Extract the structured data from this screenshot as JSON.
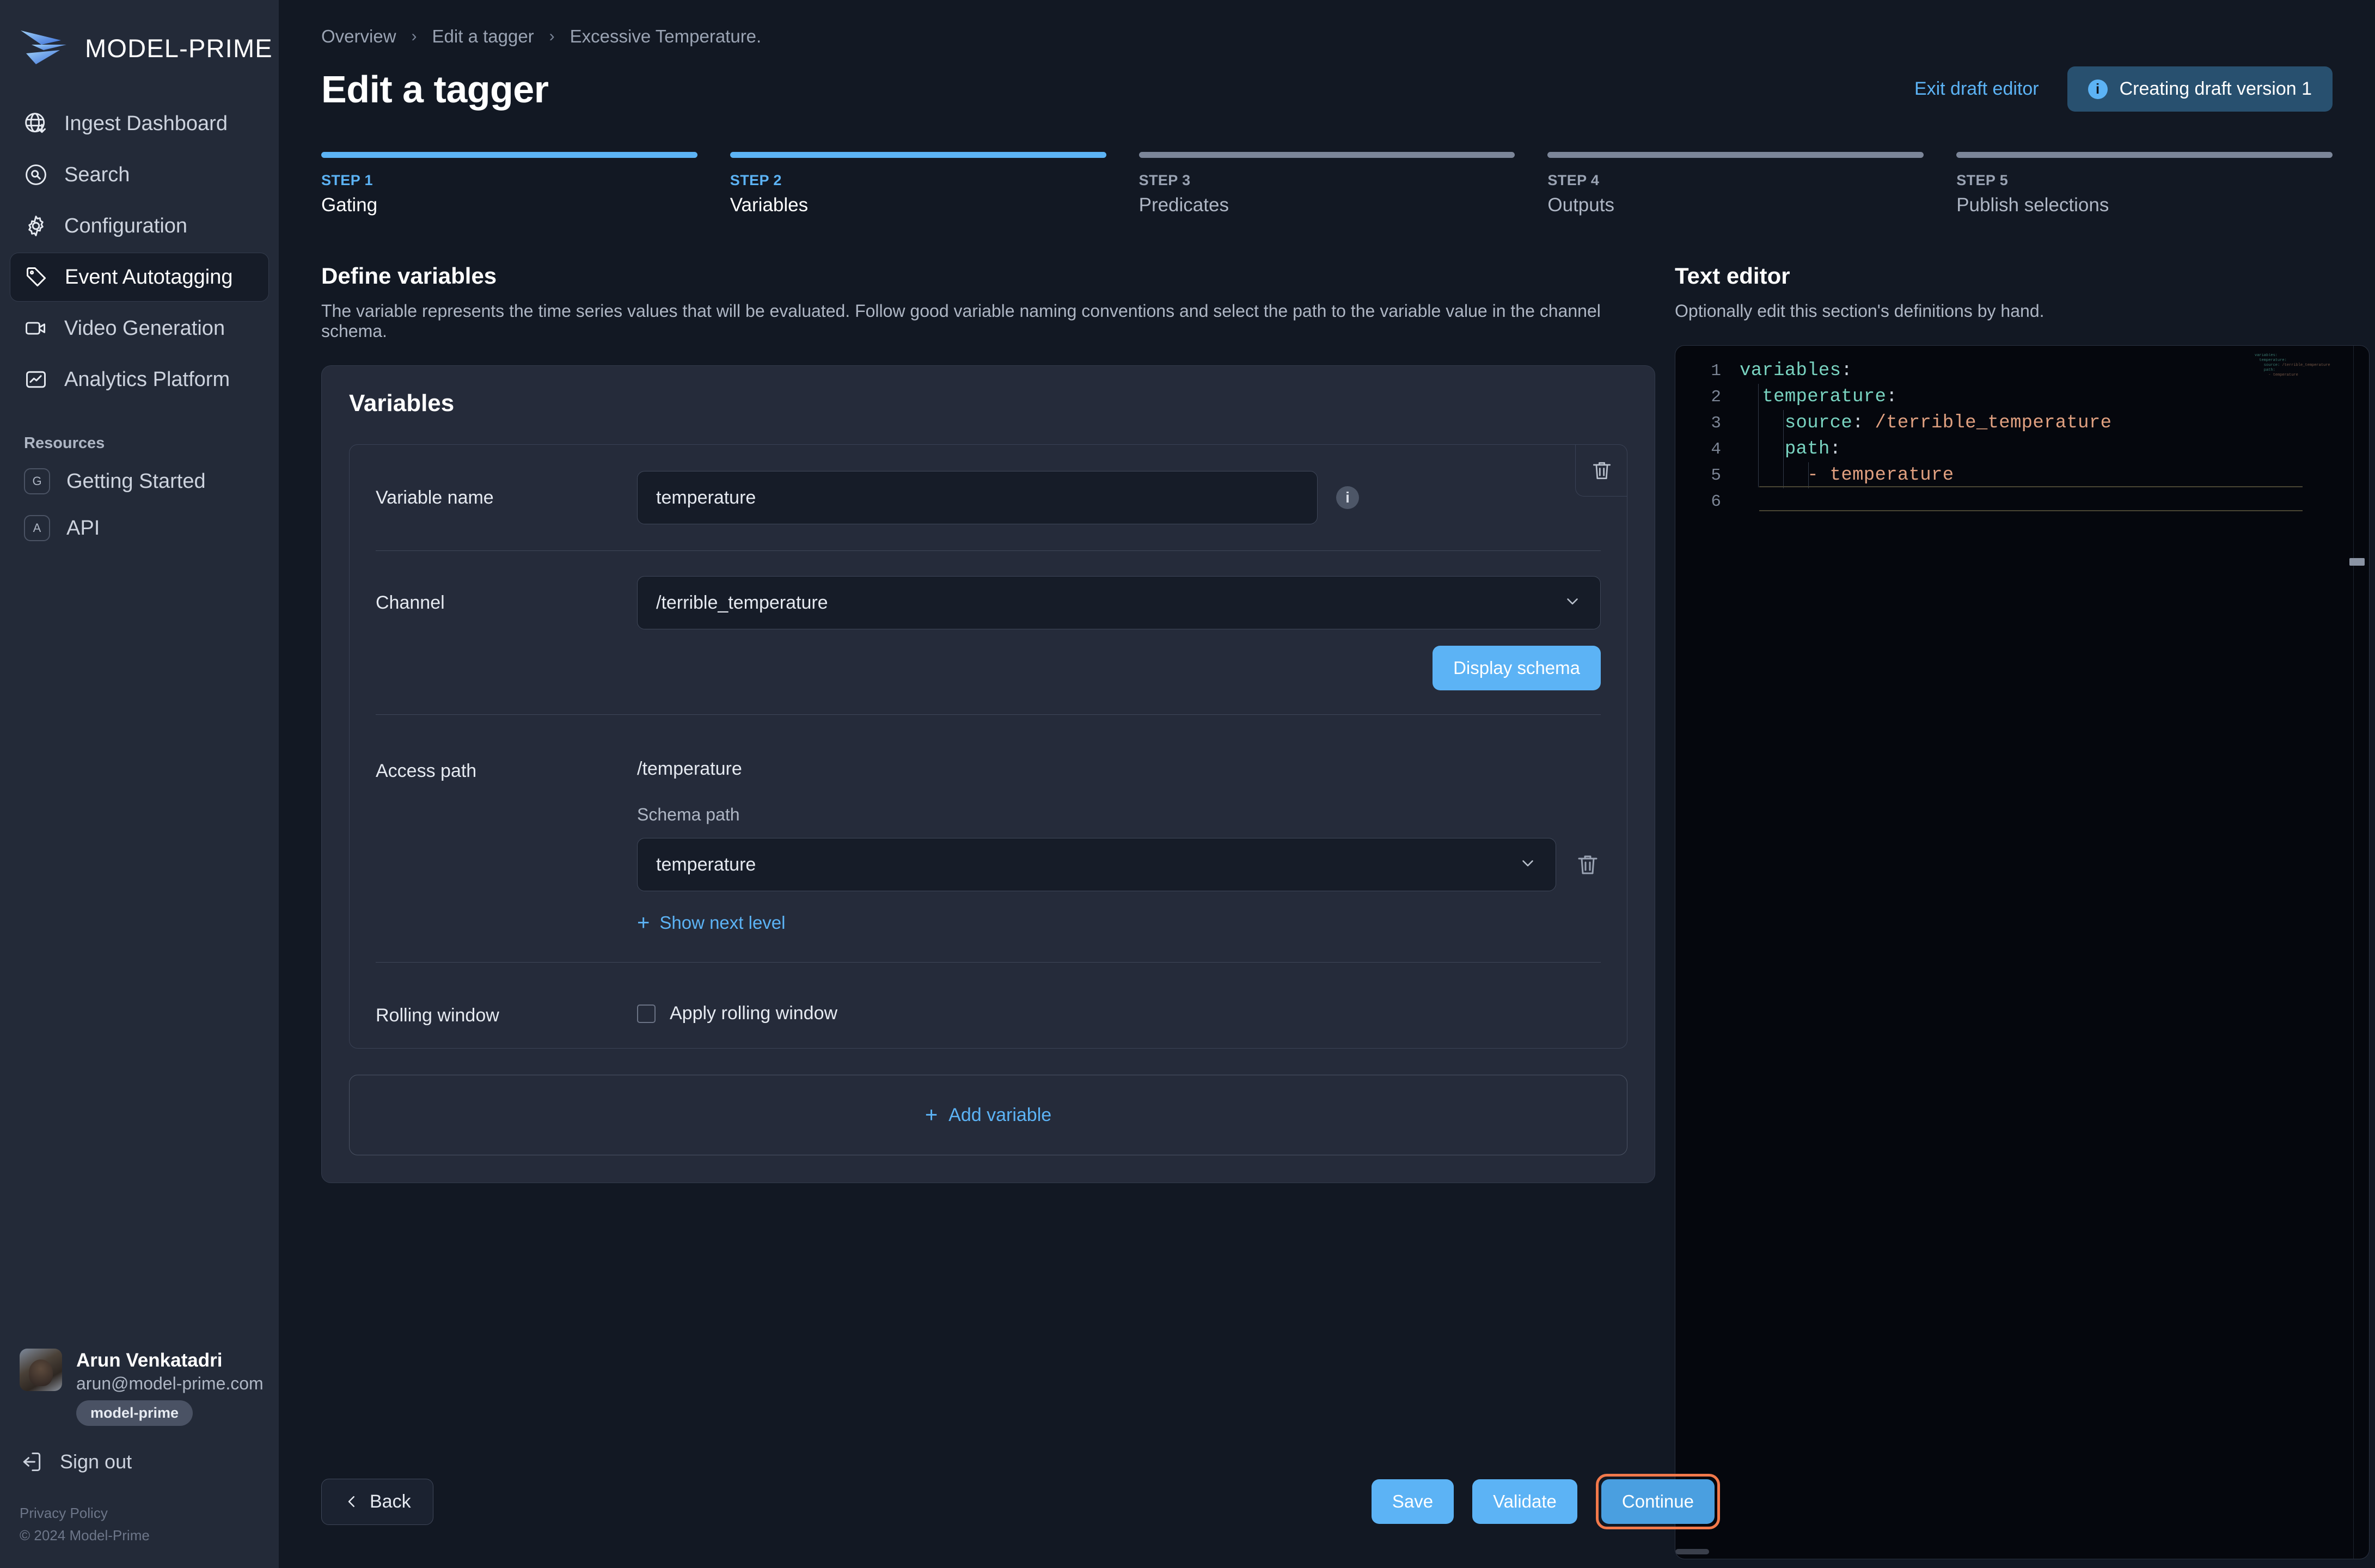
{
  "brand": {
    "name": "MODEL-PRIME"
  },
  "sidebar": {
    "nav": [
      {
        "label": "Ingest Dashboard",
        "icon": "globe-download-icon"
      },
      {
        "label": "Search",
        "icon": "search-circle-icon"
      },
      {
        "label": "Configuration",
        "icon": "gear-icon"
      },
      {
        "label": "Event Autotagging",
        "icon": "tag-icon"
      },
      {
        "label": "Video Generation",
        "icon": "video-camera-icon"
      },
      {
        "label": "Analytics Platform",
        "icon": "chart-image-icon"
      }
    ],
    "resources_heading": "Resources",
    "resources": [
      {
        "label": "Getting Started",
        "badge": "G"
      },
      {
        "label": "API",
        "badge": "A"
      }
    ],
    "user": {
      "name": "Arun Venkatadri",
      "email": "arun@model-prime.com",
      "org": "model-prime"
    },
    "sign_out": "Sign out",
    "privacy": "Privacy Policy",
    "copyright": "© 2024 Model-Prime"
  },
  "header": {
    "breadcrumbs": [
      "Overview",
      "Edit a tagger",
      "Excessive Temperature."
    ],
    "separator": "›",
    "title": "Edit a tagger",
    "exit_draft_label": "Exit draft editor",
    "draft_badge": "Creating draft version 1",
    "info_glyph": "i"
  },
  "steps": [
    {
      "num": "STEP 1",
      "name": "Gating",
      "state": "done"
    },
    {
      "num": "STEP 2",
      "name": "Variables",
      "state": "active"
    },
    {
      "num": "STEP 3",
      "name": "Predicates",
      "state": "todo"
    },
    {
      "num": "STEP 4",
      "name": "Outputs",
      "state": "todo"
    },
    {
      "num": "STEP 5",
      "name": "Publish selections",
      "state": "todo"
    }
  ],
  "define": {
    "title": "Define variables",
    "subtitle": "The variable represents the time series values that will be evaluated. Follow good variable naming conventions and select the path to the variable value in the channel schema."
  },
  "variables_panel": {
    "heading": "Variables",
    "variable_name_label": "Variable name",
    "variable_name_value": "temperature",
    "channel_label": "Channel",
    "channel_value": "/terrible_temperature",
    "display_schema_label": "Display schema",
    "access_path_label": "Access path",
    "access_path_value": "/temperature",
    "schema_path_label": "Schema path",
    "schema_path_value": "temperature",
    "show_next_level_label": "Show next level",
    "rolling_window_label": "Rolling window",
    "apply_rolling_window_label": "Apply rolling window",
    "apply_rolling_window_checked": false,
    "add_variable_label": "Add variable"
  },
  "editor": {
    "title": "Text editor",
    "subtitle": "Optionally edit this section's definitions by hand.",
    "lines": [
      {
        "n": "1",
        "indent": 0,
        "key": "variables",
        "colon": ":",
        "value": ""
      },
      {
        "n": "2",
        "indent": 1,
        "key": "temperature",
        "colon": ":",
        "value": ""
      },
      {
        "n": "3",
        "indent": 2,
        "key": "source",
        "colon": ":",
        "value": "/terrible_temperature"
      },
      {
        "n": "4",
        "indent": 2,
        "key": "path",
        "colon": ":",
        "value": ""
      },
      {
        "n": "5",
        "indent": 3,
        "key": "",
        "colon": "-",
        "value": "temperature"
      },
      {
        "n": "6",
        "indent": 0,
        "key": "",
        "colon": "",
        "value": ""
      }
    ],
    "minimap_text": "variables:\n  temperature:\n    source: /terrible_temperature\n    path:\n      - temperature"
  },
  "footer": {
    "back_label": "Back",
    "save_label": "Save",
    "validate_label": "Validate",
    "continue_label": "Continue"
  },
  "colors": {
    "accent": "#5cb3f5",
    "highlight": "#f2794b",
    "sidebar_bg": "#232a38",
    "main_bg": "#121823",
    "panel_bg": "#252b3a",
    "input_bg": "#161c28",
    "editor_bg": "#05070d",
    "yaml_key": "#79d3c0",
    "yaml_value": "#e0a080"
  }
}
